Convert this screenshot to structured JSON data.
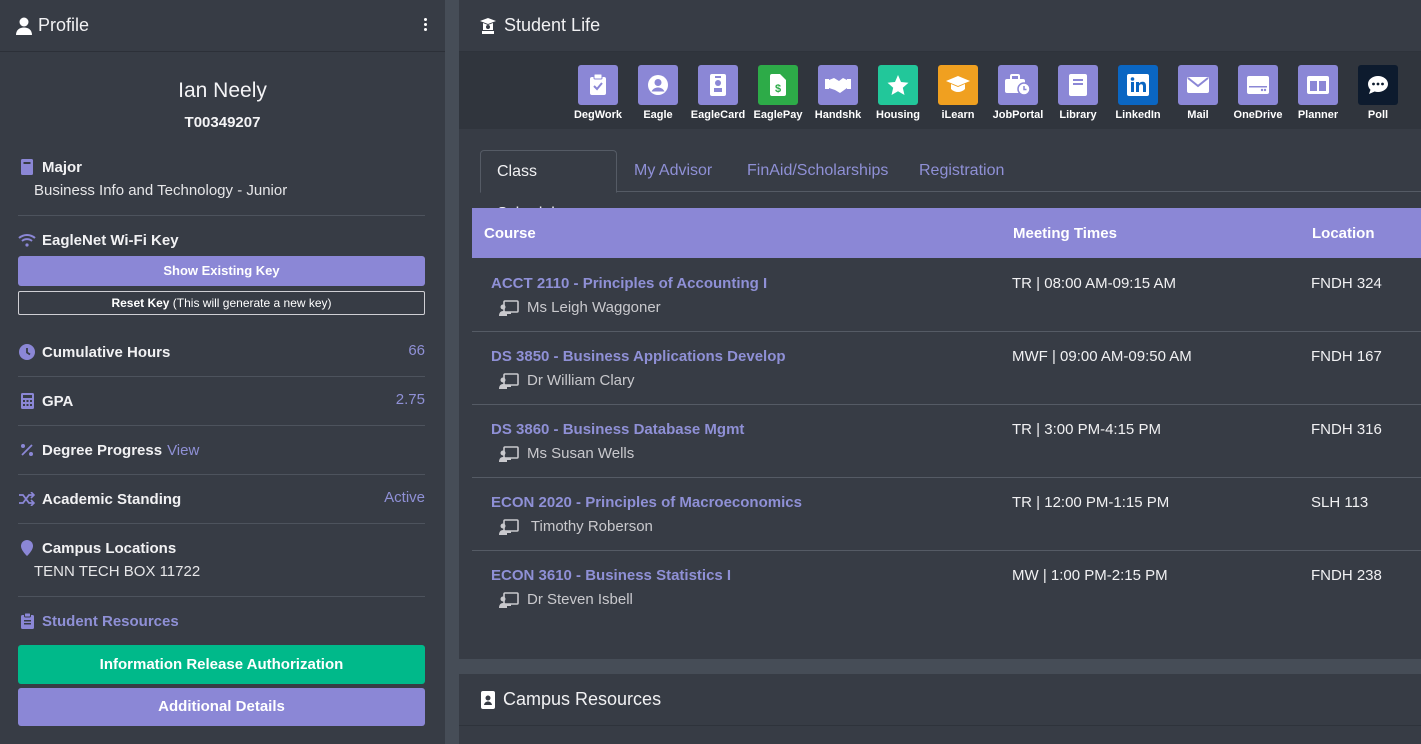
{
  "profile": {
    "title": "Profile",
    "name": "Ian Neely",
    "student_id": "T00349207",
    "major_label": "Major",
    "major_value": "Business Info and Technology - Junior",
    "wifi_label": "EagleNet Wi-Fi Key",
    "show_key_label": "Show Existing Key",
    "reset_key_label": "Reset Key",
    "reset_key_note": " (This will generate a new key)",
    "hours_label": "Cumulative Hours",
    "hours_value": "66",
    "gpa_label": "GPA",
    "gpa_value": "2.75",
    "degree_label": "Degree Progress",
    "degree_link": "View",
    "standing_label": "Academic Standing",
    "standing_value": "Active",
    "campus_label": "Campus Locations",
    "campus_value": "TENN TECH BOX 11722",
    "resources_label": "Student Resources",
    "info_release_label": "Information Release Authorization",
    "additional_label": "Additional Details"
  },
  "student_life": {
    "title": "Student Life",
    "apps": [
      {
        "label": "DegWork",
        "icon": "clipboard-check-icon",
        "color": "#8b87d6"
      },
      {
        "label": "Eagle",
        "icon": "user-circle-icon",
        "color": "#8b87d6"
      },
      {
        "label": "EagleCard",
        "icon": "id-badge-icon",
        "color": "#8b87d6"
      },
      {
        "label": "EaglePay",
        "icon": "dollar-file-icon",
        "color": "#2dab48"
      },
      {
        "label": "Handshk",
        "icon": "handshake-icon",
        "color": "#8b87d6"
      },
      {
        "label": "Housing",
        "icon": "star-icon",
        "color": "#22c79a"
      },
      {
        "label": "iLearn",
        "icon": "graduation-cap-icon",
        "color": "#f0a020"
      },
      {
        "label": "JobPortal",
        "icon": "briefcase-clock-icon",
        "color": "#8b87d6"
      },
      {
        "label": "Library",
        "icon": "book-icon",
        "color": "#8b87d6"
      },
      {
        "label": "LinkedIn",
        "icon": "linkedin-icon",
        "color": "#0a66c2"
      },
      {
        "label": "Mail",
        "icon": "envelope-icon",
        "color": "#8b87d6"
      },
      {
        "label": "OneDrive",
        "icon": "hdd-icon",
        "color": "#8b87d6"
      },
      {
        "label": "Planner",
        "icon": "columns-icon",
        "color": "#8b87d6"
      },
      {
        "label": "Poll",
        "icon": "comment-dots-icon",
        "color": "#0d1b2e"
      }
    ],
    "tabs": [
      "Class Schedule",
      "My Advisor",
      "FinAid/Scholarships",
      "Registration"
    ],
    "active_tab": "Class Schedule",
    "columns": [
      "Course",
      "Meeting Times",
      "Location"
    ],
    "rows": [
      {
        "course": "ACCT 2110 - Principles of Accounting I",
        "instructor": "Ms Leigh Waggoner",
        "times": "TR | 08:00 AM-09:15 AM",
        "location": "FNDH 324"
      },
      {
        "course": "DS 3850 - Business Applications Develop",
        "instructor": "Dr William Clary",
        "times": "MWF | 09:00 AM-09:50 AM",
        "location": "FNDH 167"
      },
      {
        "course": "DS 3860 - Business Database Mgmt",
        "instructor": "Ms Susan Wells",
        "times": "TR | 3:00 PM-4:15 PM",
        "location": "FNDH 316"
      },
      {
        "course": "ECON 2020 - Principles of Macroeconomics",
        "instructor": " Timothy Roberson",
        "times": "TR | 12:00 PM-1:15 PM",
        "location": "SLH 113"
      },
      {
        "course": "ECON 3610 - Business Statistics I",
        "instructor": "Dr Steven Isbell",
        "times": "MW | 1:00 PM-2:15 PM",
        "location": "FNDH 238"
      }
    ]
  },
  "campus_resources": {
    "title": "Campus Resources"
  },
  "colors": {
    "accent": "#8b87d6",
    "green": "#00b98a",
    "panel": "#373c45",
    "background": "#464d57"
  }
}
